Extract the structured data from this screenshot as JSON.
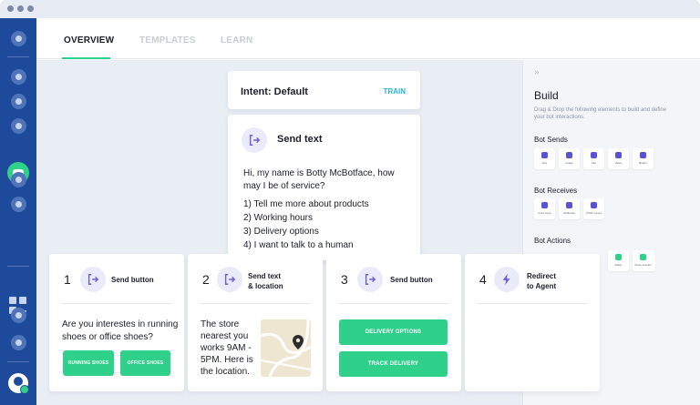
{
  "nav": {
    "tabs": [
      {
        "label": "OVERVIEW"
      },
      {
        "label": "TEMPLATES"
      },
      {
        "label": "LEARN"
      }
    ]
  },
  "intent": {
    "title": "Intent: Default",
    "train_label": "TRAIN"
  },
  "send_text": {
    "title": "Send text",
    "message": "Hi, my name is Botty McBotface, how may I be of service?",
    "options": [
      "1) Tell me more about products",
      "2) Working hours",
      "3) Delivery options",
      "4) I want to talk to a human"
    ]
  },
  "steps": [
    {
      "number": "1",
      "title": "Send button",
      "question": "Are you interestes in running shoes or office shoes?",
      "buttons": [
        "RUNNING SHOES",
        "OFFICE SHOES"
      ]
    },
    {
      "number": "2",
      "title_line1": "Send text",
      "title_line2": "& location",
      "text": "The store nearest you works 9AM - 5PM. Here is the location."
    },
    {
      "number": "3",
      "title": "Send button",
      "buttons": [
        "DELIVERY OPTIONS",
        "TRACK DELIVERY"
      ]
    },
    {
      "number": "4",
      "title_line1": "Redirect",
      "title_line2": "to Agent"
    }
  ],
  "build": {
    "title": "Build",
    "description": "Drag & Drop the following elements to build and define your bot interactions.",
    "sections": [
      {
        "label": "Bot Sends",
        "items": [
          "Text",
          "Image",
          "File",
          "Video",
          "Button"
        ]
      },
      {
        "label": "Bot Receives",
        "items": [
          "Input input",
          "Attributes",
          "CSAT survey"
        ]
      },
      {
        "label": "Bot Actions",
        "items": [
          "Delay",
          "Close session"
        ]
      }
    ]
  },
  "colors": {
    "sidebar": "#1e4a9c",
    "accent_green": "#2ed08a",
    "accent_purple": "#6b60d9",
    "train_blue": "#2bb3d6",
    "canvas_bg": "#e9eef5"
  }
}
